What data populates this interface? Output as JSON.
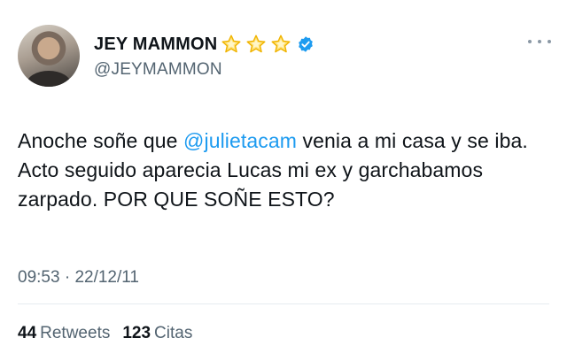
{
  "author": {
    "display_name": "JEY MAMMON",
    "handle": "@JEYMAMMON",
    "badges": [
      "star-icon",
      "star-icon",
      "star-icon",
      "verified-badge-icon"
    ]
  },
  "tweet": {
    "text_before": "Anoche soñe que ",
    "mention": "@julietacam",
    "text_after": " venia a mi casa y se iba. Acto seguido aparecia Lucas mi ex y garchabamos zarpado. POR QUE SOÑE ESTO?",
    "time": "09:53",
    "separator": "·",
    "date": "22/12/11"
  },
  "stats": {
    "retweets_count": "44",
    "retweets_label": "Retweets",
    "quotes_count": "123",
    "quotes_label": "Citas"
  },
  "colors": {
    "mention": "#1d9bf0",
    "verified": "#1d9bf0",
    "star": "#f5c000",
    "secondary_text": "#536471"
  }
}
